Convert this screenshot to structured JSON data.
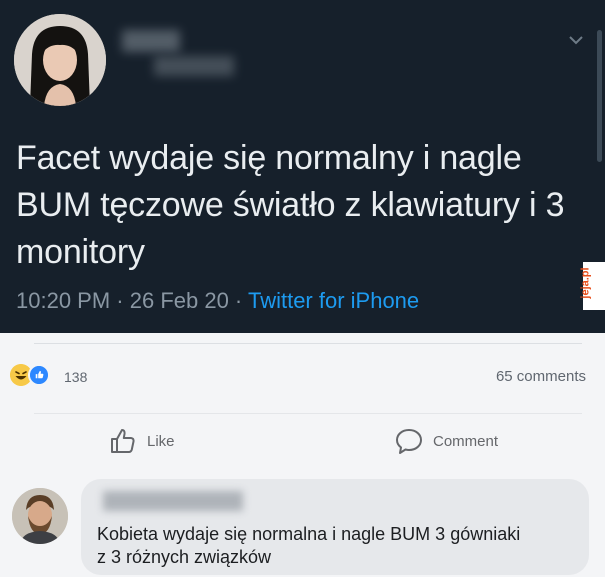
{
  "tweet": {
    "text": "Facet wydaje się normalny i nagle BUM tęczowe światło z klawiatury i 3 monitory",
    "time": "10:20 PM",
    "date": "26 Feb 20",
    "source": "Twitter for iPhone",
    "separator": " · "
  },
  "watermark": "jeja.pl",
  "facebook": {
    "reaction_count": "138",
    "comments_count": "65 comments",
    "like_label": "Like",
    "comment_label": "Comment",
    "comment": {
      "text": "Kobieta wydaje się normalna i nagle BUM 3 gówniaki z 3 różnych związków"
    }
  },
  "colors": {
    "tweet_bg": "#16202b",
    "tweet_text": "#e9edf0",
    "link_blue": "#1d9bf0",
    "fb_bg": "#f4f5f7",
    "bubble_bg": "#e6e8eb"
  }
}
